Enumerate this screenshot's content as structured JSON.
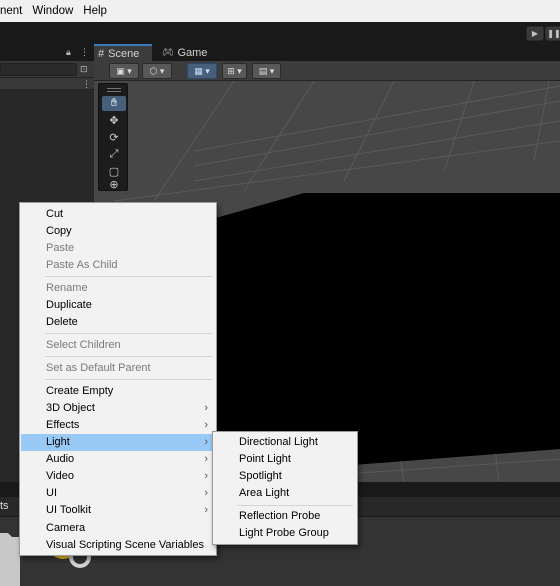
{
  "menubar": {
    "items": [
      "nent",
      "Window",
      "Help"
    ]
  },
  "hierarchy": {
    "lock_icon": "lock-icon",
    "menu_icon": "kebab-icon"
  },
  "scene": {
    "tabs": [
      {
        "label": "Scene",
        "icon": "grid-icon"
      },
      {
        "label": "Game",
        "icon": "gamepad-icon"
      }
    ],
    "tools": [
      "hand-icon",
      "move-icon",
      "rotate-icon",
      "scale-icon",
      "rect-icon",
      "transform-icon"
    ]
  },
  "bottom": {
    "tab_label": "ts"
  },
  "context_menu": {
    "items": [
      {
        "label": "Cut"
      },
      {
        "label": "Copy"
      },
      {
        "label": "Paste",
        "disabled": true
      },
      {
        "label": "Paste As Child",
        "disabled": true
      },
      {
        "label": "Rename",
        "disabled": true
      },
      {
        "label": "Duplicate"
      },
      {
        "label": "Delete"
      },
      {
        "label": "Select Children",
        "disabled": true
      },
      {
        "label": "Set as Default Parent",
        "disabled": true
      },
      {
        "label": "Create Empty"
      },
      {
        "label": "3D Object",
        "submenu": true
      },
      {
        "label": "Effects",
        "submenu": true
      },
      {
        "label": "Light",
        "submenu": true,
        "highlighted": true
      },
      {
        "label": "Audio",
        "submenu": true
      },
      {
        "label": "Video",
        "submenu": true
      },
      {
        "label": "UI",
        "submenu": true
      },
      {
        "label": "UI Toolkit",
        "submenu": true
      },
      {
        "label": "Camera"
      },
      {
        "label": "Visual Scripting Scene Variables"
      }
    ],
    "arrow": "›"
  },
  "light_submenu": {
    "items": [
      {
        "label": "Directional Light"
      },
      {
        "label": "Point Light"
      },
      {
        "label": "Spotlight"
      },
      {
        "label": "Area Light"
      },
      {
        "label": "Reflection Probe"
      },
      {
        "label": "Light Probe Group"
      }
    ]
  },
  "colors": {
    "highlight": "#99c9f5",
    "scene_dark": "#000000",
    "accent": "#3a79bb"
  }
}
